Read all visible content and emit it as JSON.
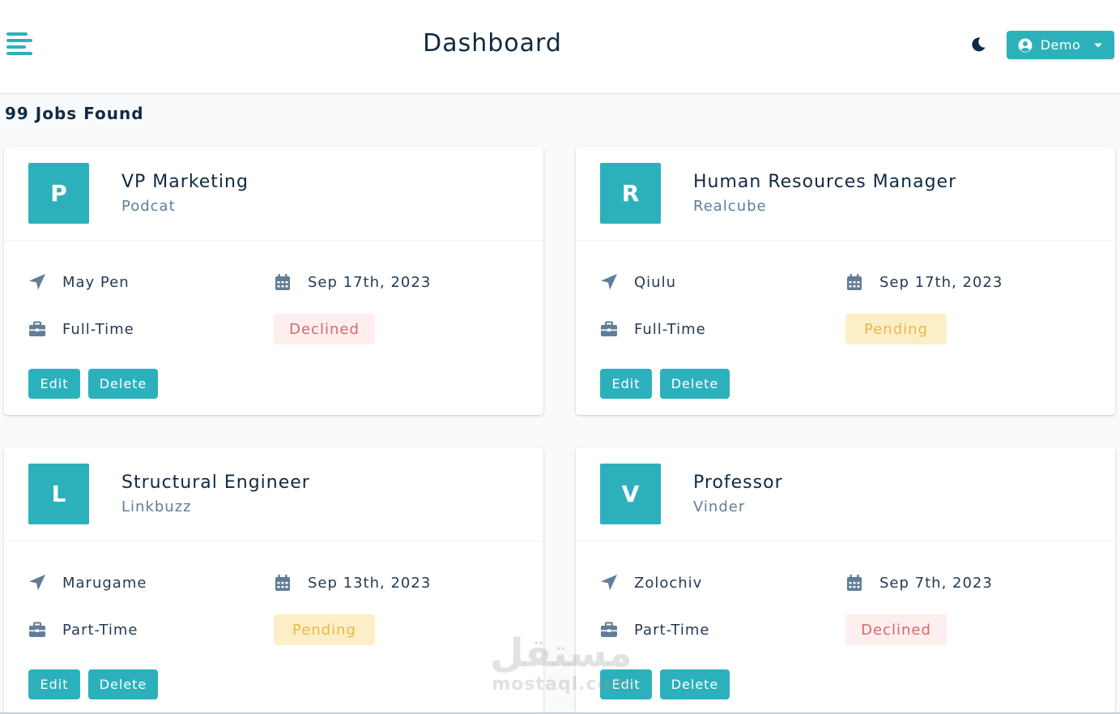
{
  "navbar": {
    "title": "Dashboard",
    "menu_icon": "hamburger-menu-icon",
    "theme_icon": "moon-icon",
    "user_icon": "user-circle-icon",
    "user_label": "Demo",
    "caret_icon": "caret-down-icon"
  },
  "jobs_count": "99 Jobs Found",
  "labels": {
    "edit": "Edit",
    "delete": "Delete"
  },
  "colors": {
    "primary": "#2cb1bc",
    "declined_bg": "#ffeeee",
    "declined_text": "#d66a6a",
    "pending_bg": "#fcefc7",
    "pending_text": "#e9b949"
  },
  "jobs": [
    {
      "initial": "P",
      "position": "VP Marketing",
      "company": "Podcat",
      "location": "May Pen",
      "date": "Sep 17th, 2023",
      "type": "Full-Time",
      "status": "Declined"
    },
    {
      "initial": "R",
      "position": "Human Resources Manager",
      "company": "Realcube",
      "location": "Qiulu",
      "date": "Sep 17th, 2023",
      "type": "Full-Time",
      "status": "Pending"
    },
    {
      "initial": "L",
      "position": "Structural Engineer",
      "company": "Linkbuzz",
      "location": "Marugame",
      "date": "Sep 13th, 2023",
      "type": "Part-Time",
      "status": "Pending"
    },
    {
      "initial": "V",
      "position": "Professor",
      "company": "Vinder",
      "location": "Zolochiv",
      "date": "Sep 7th, 2023",
      "type": "Part-Time",
      "status": "Declined"
    }
  ],
  "watermark": {
    "arabic": "مستقل",
    "latin": "mostaql.com"
  }
}
